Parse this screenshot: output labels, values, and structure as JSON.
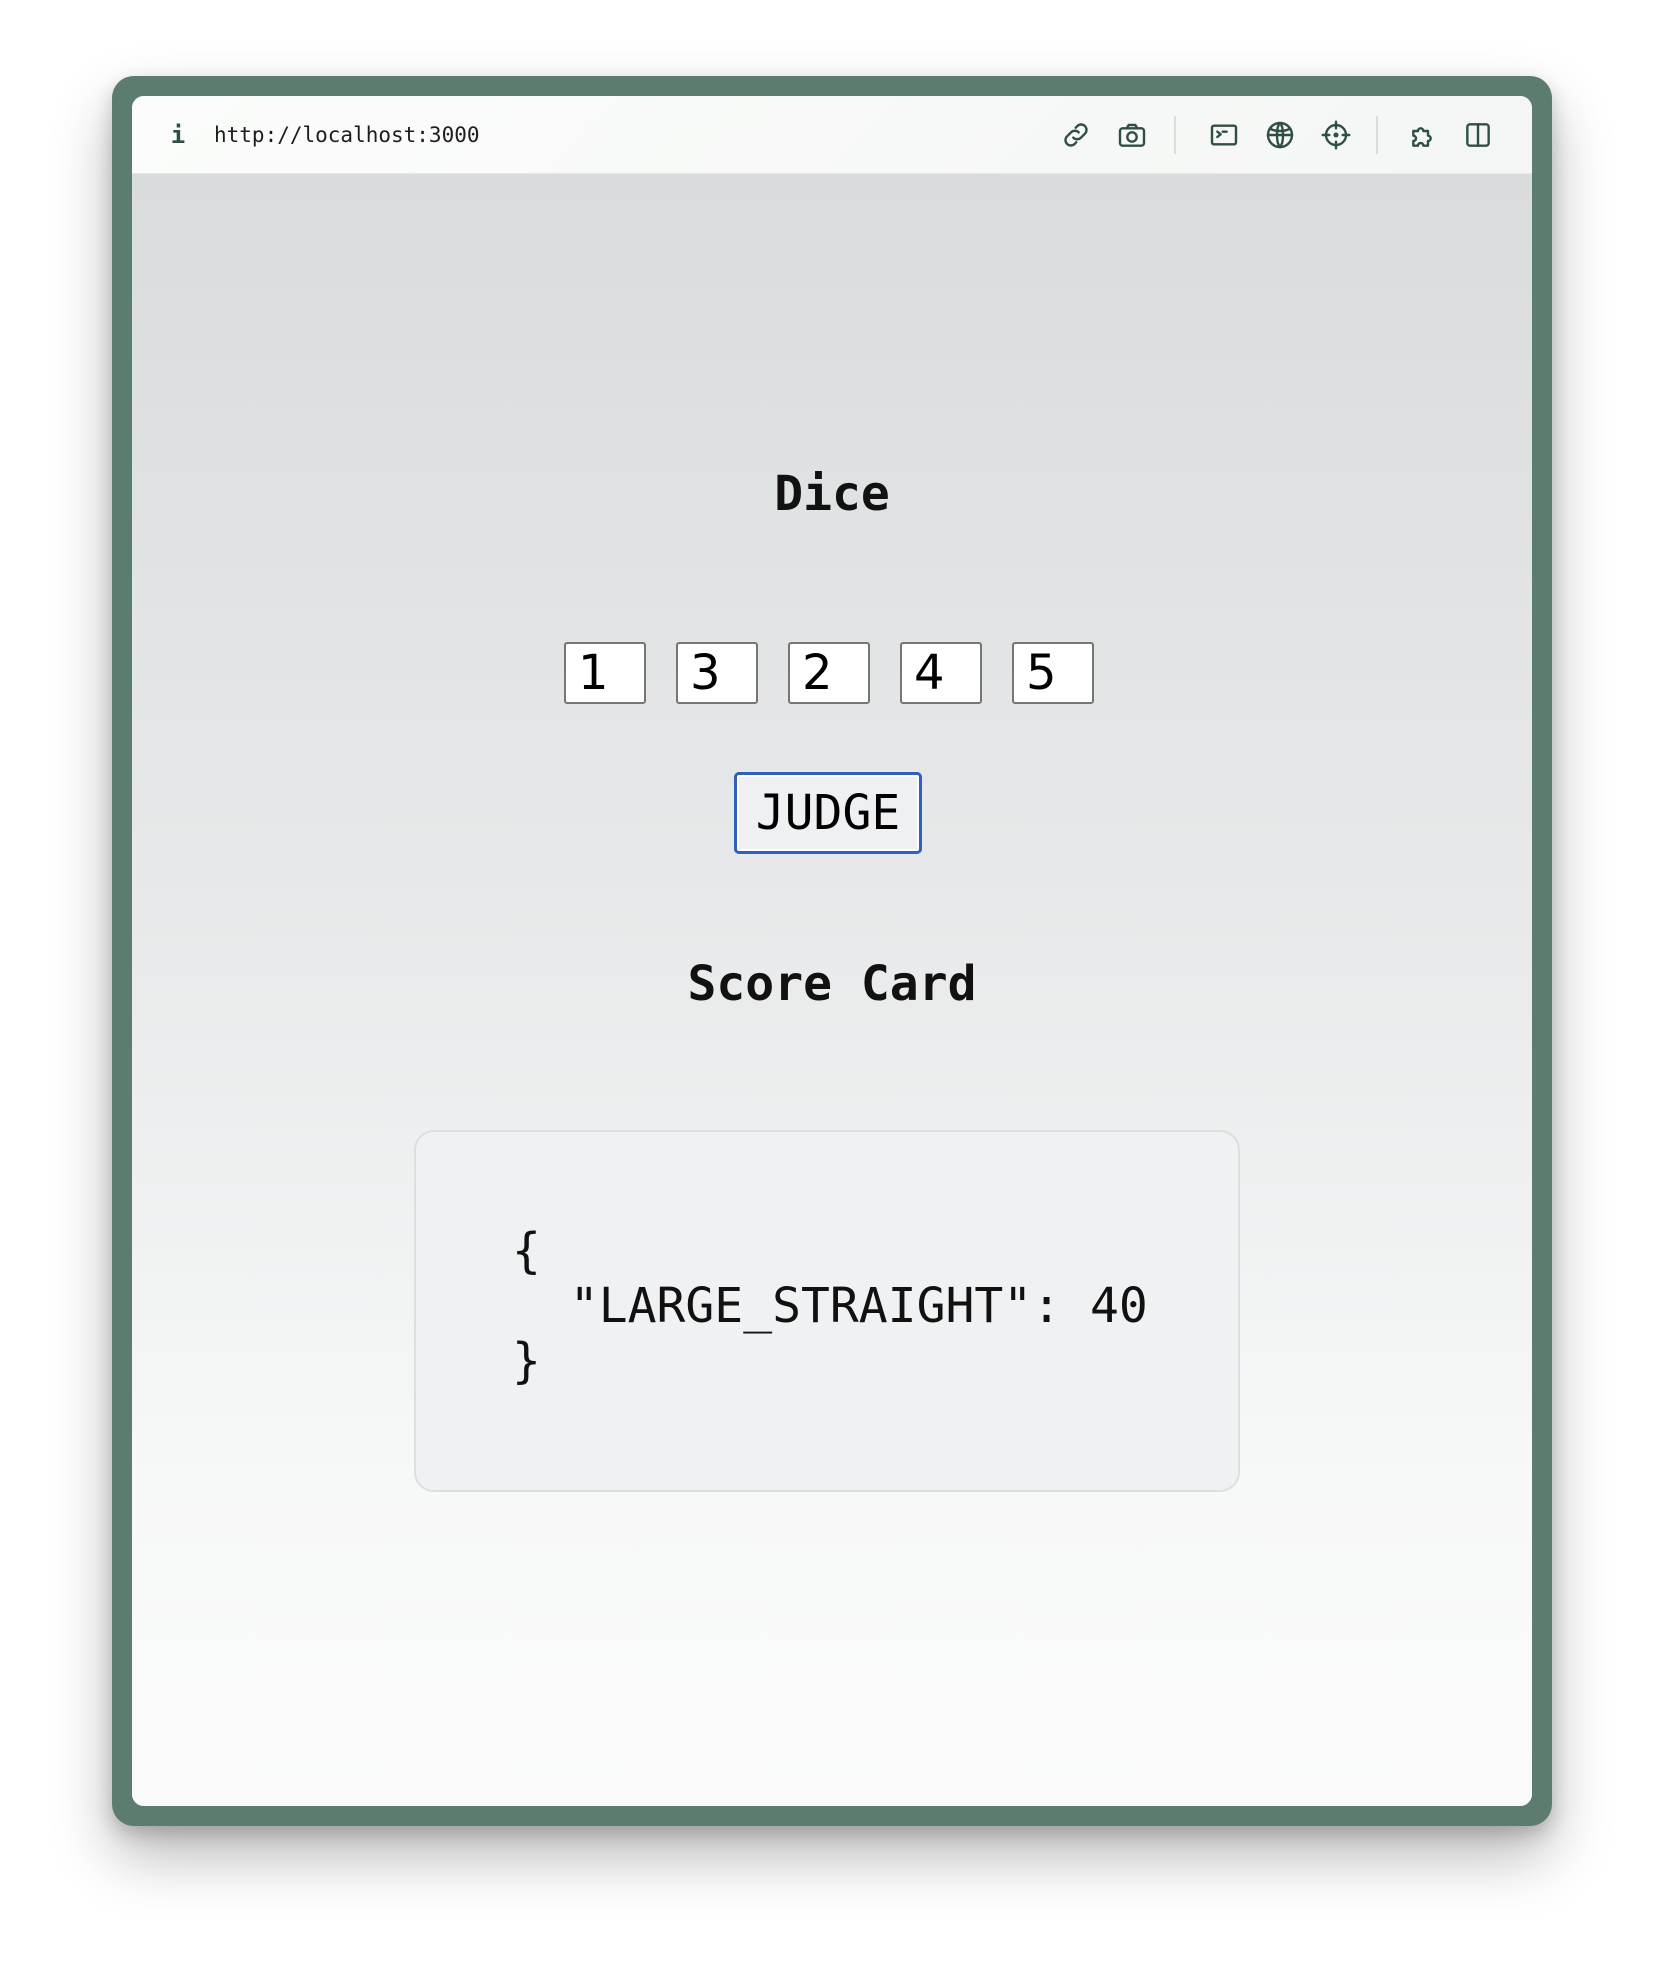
{
  "browser": {
    "url": "http://localhost:3000",
    "info_icon": "info-icon",
    "toolbar_icons": [
      "link-icon",
      "camera-icon",
      "terminal-icon",
      "globe-icon",
      "crosshair-icon",
      "puzzle-icon",
      "split-view-icon"
    ]
  },
  "dice_section": {
    "title": "Dice",
    "dice": [
      "1",
      "3",
      "2",
      "4",
      "5"
    ],
    "judge_label": "JUDGE"
  },
  "score_section": {
    "title": "Score Card",
    "json_text": "{\n  \"LARGE_STRAIGHT\": 40\n}",
    "entries": [
      {
        "key": "LARGE_STRAIGHT",
        "value": 40
      }
    ]
  },
  "colors": {
    "window_frame": "#5b7c6e",
    "button_border": "#2f5fbf",
    "icon": "#2f4f45"
  }
}
